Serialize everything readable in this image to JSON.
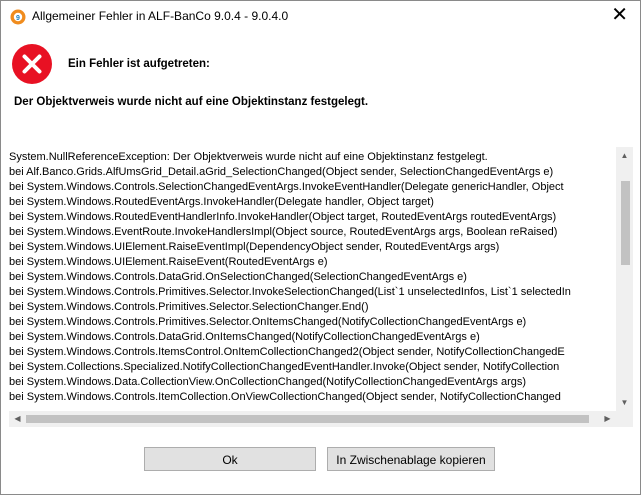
{
  "window": {
    "title": "Allgemeiner Fehler in ALF-BanCo 9.0.4 - 9.0.4.0",
    "close_glyph": "✕"
  },
  "error": {
    "heading": "Ein Fehler ist aufgetreten:",
    "message": "Der Objektverweis wurde nicht auf eine Objektinstanz festgelegt.",
    "icon": "error-icon",
    "color": "#e81123"
  },
  "trace": {
    "lines": [
      "System.NullReferenceException: Der Objektverweis wurde nicht auf eine Objektinstanz festgelegt.",
      "   bei Alf.Banco.Grids.AlfUmsGrid_Detail.aGrid_SelectionChanged(Object sender, SelectionChangedEventArgs e)",
      "   bei System.Windows.Controls.SelectionChangedEventArgs.InvokeEventHandler(Delegate genericHandler, Object",
      "   bei System.Windows.RoutedEventArgs.InvokeHandler(Delegate handler, Object target)",
      "   bei System.Windows.RoutedEventHandlerInfo.InvokeHandler(Object target, RoutedEventArgs routedEventArgs)",
      "   bei System.Windows.EventRoute.InvokeHandlersImpl(Object source, RoutedEventArgs args, Boolean reRaised)",
      "   bei System.Windows.UIElement.RaiseEventImpl(DependencyObject sender, RoutedEventArgs args)",
      "   bei System.Windows.UIElement.RaiseEvent(RoutedEventArgs e)",
      "   bei System.Windows.Controls.DataGrid.OnSelectionChanged(SelectionChangedEventArgs e)",
      "   bei System.Windows.Controls.Primitives.Selector.InvokeSelectionChanged(List`1 unselectedInfos, List`1 selectedIn",
      "   bei System.Windows.Controls.Primitives.Selector.SelectionChanger.End()",
      "   bei System.Windows.Controls.Primitives.Selector.OnItemsChanged(NotifyCollectionChangedEventArgs e)",
      "   bei System.Windows.Controls.DataGrid.OnItemsChanged(NotifyCollectionChangedEventArgs e)",
      "   bei System.Windows.Controls.ItemsControl.OnItemCollectionChanged2(Object sender, NotifyCollectionChangedE",
      "   bei System.Collections.Specialized.NotifyCollectionChangedEventHandler.Invoke(Object sender, NotifyCollection",
      "   bei System.Windows.Data.CollectionView.OnCollectionChanged(NotifyCollectionChangedEventArgs args)",
      "   bei System.Windows.Controls.ItemCollection.OnViewCollectionChanged(Object sender, NotifyCollectionChanged"
    ]
  },
  "buttons": {
    "ok": "Ok",
    "copy": "In Zwischenablage kopieren"
  }
}
